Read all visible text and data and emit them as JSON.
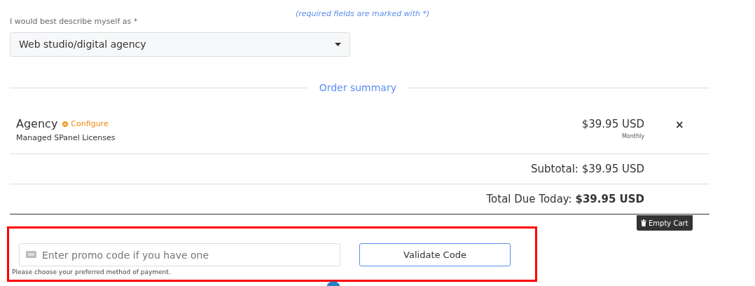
{
  "required_note": "(required fields are marked with *)",
  "describe_field": {
    "label": "I would best describe myself as *",
    "value": "Web studio/digital agency"
  },
  "order_summary": {
    "title": "Order summary",
    "items": [
      {
        "name": "Agency",
        "configure_link": "Configure",
        "group": "Managed SPanel Licenses",
        "price": "$39.95 USD",
        "cycle": "Monthly",
        "remove": "×"
      }
    ],
    "subtotal": "Subtotal: $39.95 USD",
    "total_label": "Total Due Today:",
    "total_value": "$39.95 USD",
    "empty_cart_button": "Empty Cart"
  },
  "promo": {
    "placeholder": "Enter promo code if you have one",
    "validate_button": "Validate Code",
    "highlighted": true
  },
  "payment_hint": "Please choose your preferred method of payment."
}
